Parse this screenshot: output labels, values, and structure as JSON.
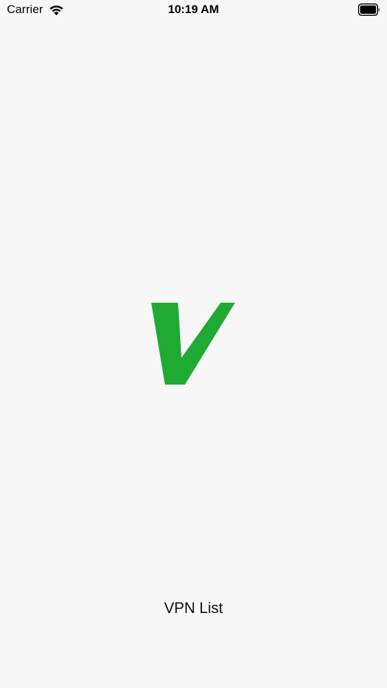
{
  "status_bar": {
    "carrier": "Carrier",
    "time": "10:19 AM",
    "wifi_icon": "wifi-icon",
    "battery_icon": "battery-icon",
    "battery_level": 1.0
  },
  "splash": {
    "logo_icon": "v-logo-icon",
    "logo_color": "#1faa33",
    "app_name": "VPN List"
  },
  "colors": {
    "background": "#f7f7f7",
    "text": "#000000",
    "accent": "#1faa33"
  }
}
